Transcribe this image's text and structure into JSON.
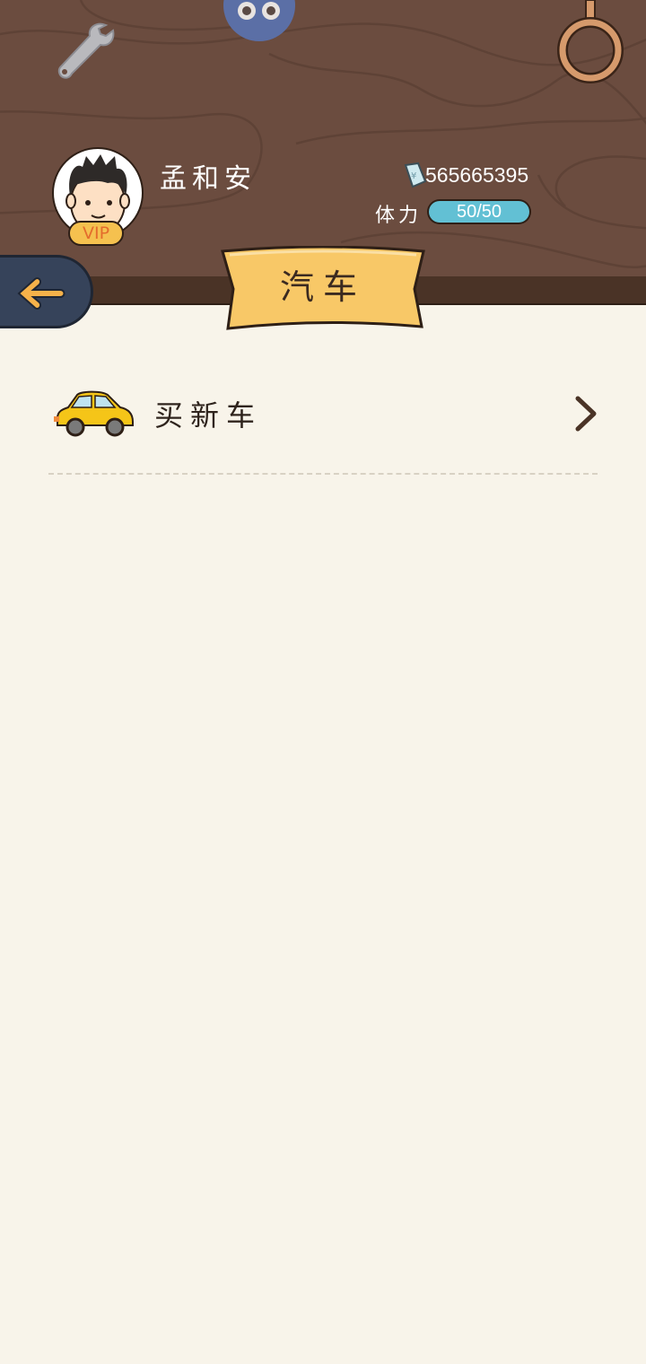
{
  "header": {
    "username": "孟和安",
    "vip_label": "VIP",
    "money_value": "565665395",
    "stamina_label": "体力",
    "stamina_text": "50/50",
    "stamina_fraction": 1.0
  },
  "title": {
    "text": "汽车"
  },
  "list": {
    "items": [
      {
        "label": "买新车",
        "icon": "car-icon"
      }
    ]
  },
  "icons": {
    "settings": "wrench-icon",
    "top_center": "monster-icon",
    "top_right": "ring-icon",
    "back": "back-arrow-icon",
    "money": "money-icon",
    "chevron": "chevron-right-icon"
  },
  "colors": {
    "wood": "#6b4c3f",
    "wood_dark": "#4a3326",
    "content_bg": "#f8f4ea",
    "banner": "#f8c867",
    "stamina_fill": "#62c0d4",
    "back_button": "#36435a",
    "car": "#f5c518"
  }
}
